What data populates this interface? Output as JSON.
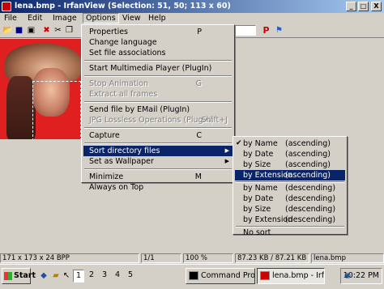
{
  "window": {
    "title": "lena.bmp - IrfanView (Selection: 51, 50; 113 x 60)",
    "controls": [
      "_",
      "□",
      "X"
    ]
  },
  "menubar": [
    "File",
    "Edit",
    "Image",
    "Options",
    "View",
    "Help"
  ],
  "toolbar": {
    "icons": [
      "open-folder-icon",
      "save-icon",
      "disk-icon",
      "delete-icon",
      "cut-icon",
      "copy-icon"
    ],
    "extra_icons": [
      "paypal-icon",
      "irfanview-logo-icon"
    ],
    "p_label": "P"
  },
  "options_menu": [
    {
      "label": "Properties",
      "shortcut": "P"
    },
    {
      "label": "Change language"
    },
    {
      "label": "Set file associations"
    },
    {
      "label": "Start Multimedia Player (PlugIn)"
    },
    {
      "label": "Stop Animation",
      "shortcut": "G",
      "disabled": true
    },
    {
      "label": "Extract all frames",
      "disabled": true
    },
    {
      "label": "Send file by EMail (PlugIn)"
    },
    {
      "label": "JPG Lossless Operations (PlugIn)",
      "shortcut": "Shift+J",
      "disabled": true
    },
    {
      "label": "Capture",
      "shortcut": "C"
    },
    {
      "label": "Sort directory files",
      "submenu": true,
      "highlighted": true
    },
    {
      "label": "Set as Wallpaper",
      "submenu": true
    },
    {
      "label": "Minimize",
      "shortcut": "M"
    },
    {
      "label": "Always on Top"
    }
  ],
  "sort_submenu": [
    {
      "label": "by Name",
      "order": "(ascending)",
      "checked": true
    },
    {
      "label": "by Date",
      "order": "(ascending)"
    },
    {
      "label": "by Size",
      "order": "(ascending)"
    },
    {
      "label": "by Extension",
      "order": "(ascending)",
      "highlighted": true
    },
    {
      "label": "by Name",
      "order": "(descending)"
    },
    {
      "label": "by Date",
      "order": "(descending)"
    },
    {
      "label": "by Size",
      "order": "(descending)"
    },
    {
      "label": "by Extension",
      "order": "(descending)"
    },
    {
      "label": "No sort",
      "order": ""
    }
  ],
  "statusbar": [
    "171 x 173 x 24 BPP",
    "1/1",
    "100 %",
    "87.23 KB / 87.21 KB",
    "lena.bmp"
  ],
  "taskbar": {
    "start_label": "Start",
    "desktops": [
      "1",
      "2",
      "3",
      "4",
      "5"
    ],
    "tasks": [
      "Command Promp",
      "lena.bmp - IrfanVi"
    ],
    "clock": "10:22 PM"
  },
  "colors": {
    "title_gradient_start": "#0a246a",
    "menu_highlight": "#0a246a",
    "face": "#d4d0c8",
    "image_background": "#e02020"
  }
}
